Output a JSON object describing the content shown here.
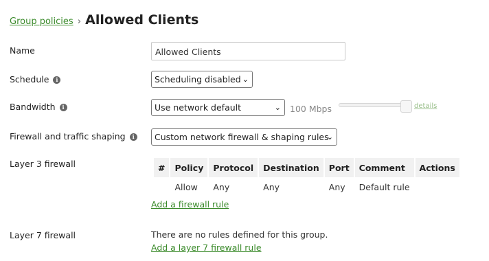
{
  "breadcrumb": {
    "parent": "Group policies",
    "separator": "›",
    "title": "Allowed Clients"
  },
  "name_row": {
    "label": "Name",
    "value": "Allowed Clients"
  },
  "schedule_row": {
    "label": "Schedule",
    "selected": "Scheduling disabled"
  },
  "bandwidth_row": {
    "label": "Bandwidth",
    "selected": "Use network default",
    "rate": "100 Mbps",
    "details": "details"
  },
  "firewall_row": {
    "label": "Firewall and traffic shaping",
    "selected": "Custom network firewall & shaping rules"
  },
  "layer3": {
    "label": "Layer 3 firewall",
    "headers": [
      "#",
      "Policy",
      "Protocol",
      "Destination",
      "Port",
      "Comment",
      "Actions"
    ],
    "rows": [
      [
        "",
        "Allow",
        "Any",
        "Any",
        "Any",
        "Default rule",
        ""
      ]
    ],
    "add_link": "Add a firewall rule"
  },
  "layer7": {
    "label": "Layer 7 firewall",
    "empty_text": "There are no rules defined for this group.",
    "add_link": "Add a layer 7 firewall rule"
  },
  "icons": {
    "info": "info-icon",
    "dropdown": "chevron-down-icon"
  }
}
